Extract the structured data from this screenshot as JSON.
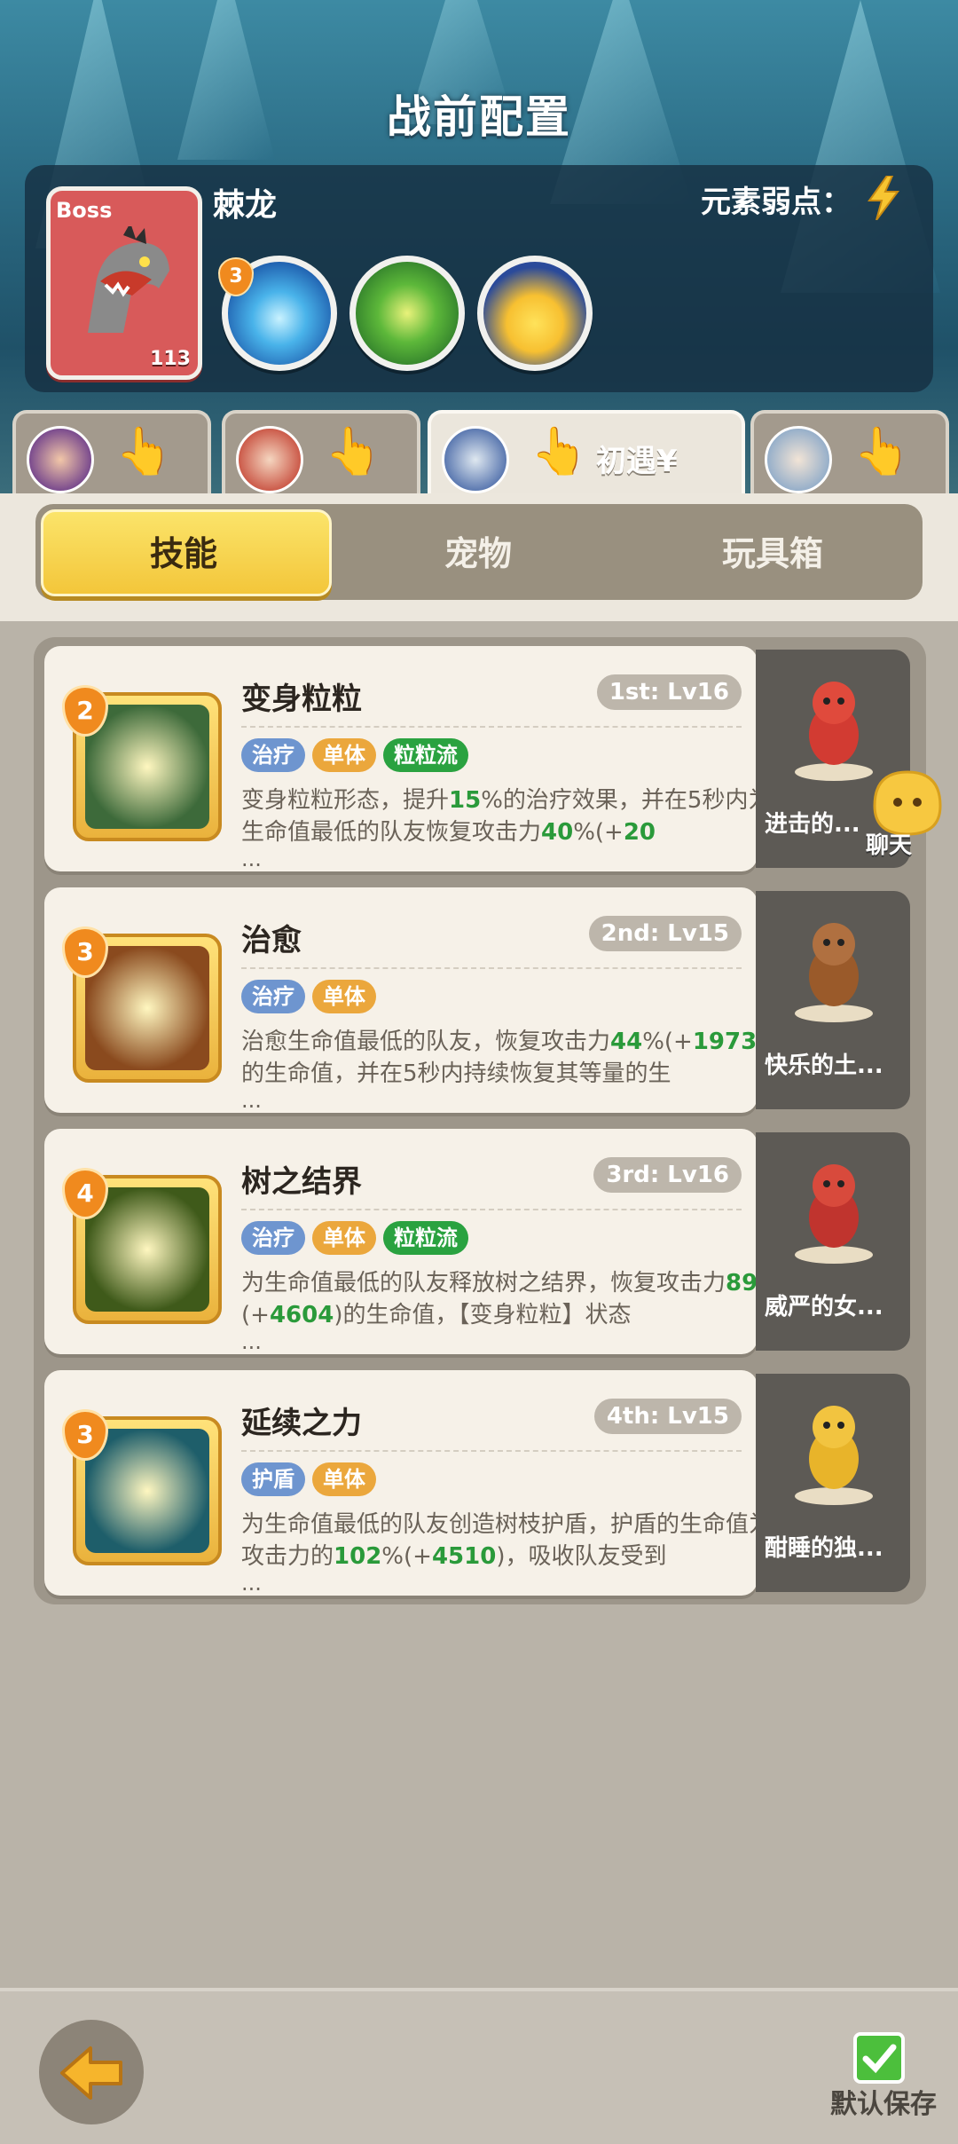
{
  "header": {
    "title": "战前配置"
  },
  "boss": {
    "tag": "Boss",
    "level": "113",
    "name": "棘龙",
    "weakness_label": "元素弱点：",
    "weakness_icon": "lightning-icon",
    "skills": [
      {
        "icon": "water-burst-icon",
        "badge": "3"
      },
      {
        "icon": "green-scroll-icon"
      },
      {
        "icon": "yellow-creature-icon"
      }
    ]
  },
  "team_tabs": [
    {
      "avatar": "hero-avatar-1"
    },
    {
      "avatar": "hero-avatar-2"
    },
    {
      "avatar": "hero-avatar-3",
      "label": "初遇¥",
      "active": true
    },
    {
      "avatar": "hero-avatar-4"
    }
  ],
  "segment": {
    "tabs": [
      "技能",
      "宠物",
      "玩具箱"
    ],
    "active": "技能"
  },
  "skills": [
    {
      "badge": "2",
      "name": "变身粒粒",
      "rank": "1st: Lv16",
      "tags": [
        {
          "label": "治疗",
          "color": "#6e95cf"
        },
        {
          "label": "单体",
          "color": "#eba73c"
        },
        {
          "label": "粒粒流",
          "color": "#2aa240"
        }
      ],
      "desc": [
        {
          "t": "变身粒粒形态，提升"
        },
        {
          "t": "15",
          "g": true
        },
        {
          "t": "%的治疗效果，并在5秒内为生命值最低的队友恢复攻击力"
        },
        {
          "t": "40",
          "g": true
        },
        {
          "t": "%(+"
        },
        {
          "t": "20",
          "g": true
        }
      ],
      "pet": "进击的...",
      "icon_color": "#3d6a3a"
    },
    {
      "badge": "3",
      "name": "治愈",
      "rank": "2nd: Lv15",
      "tags": [
        {
          "label": "治疗",
          "color": "#6e95cf"
        },
        {
          "label": "单体",
          "color": "#eba73c"
        }
      ],
      "desc": [
        {
          "t": "治愈生命值最低的队友，恢复攻击力"
        },
        {
          "t": "44",
          "g": true
        },
        {
          "t": "%(+"
        },
        {
          "t": "1973",
          "g": true
        },
        {
          "t": ")的生命值，并在5秒内持续恢复其等量的生"
        }
      ],
      "pet": "快乐的土...",
      "icon_color": "#8a4a1e"
    },
    {
      "badge": "4",
      "name": "树之结界",
      "rank": "3rd: Lv16",
      "tags": [
        {
          "label": "治疗",
          "color": "#6e95cf"
        },
        {
          "label": "单体",
          "color": "#eba73c"
        },
        {
          "label": "粒粒流",
          "color": "#2aa240"
        }
      ],
      "desc": [
        {
          "t": "为生命值最低的队友释放树之结界，恢复攻击力"
        },
        {
          "t": "89",
          "g": true
        },
        {
          "t": "%(+"
        },
        {
          "t": "4604",
          "g": true
        },
        {
          "t": ")的生命值，【变身粒粒】状态"
        }
      ],
      "pet": "威严的女...",
      "icon_color": "#3f5a1a"
    },
    {
      "badge": "3",
      "name": "延续之力",
      "rank": "4th: Lv15",
      "tags": [
        {
          "label": "护盾",
          "color": "#6e95cf"
        },
        {
          "label": "单体",
          "color": "#eba73c"
        }
      ],
      "desc": [
        {
          "t": "为生命值最低的队友创造树枝护盾，护盾的生命值为攻击力的"
        },
        {
          "t": "102",
          "g": true
        },
        {
          "t": "%(+"
        },
        {
          "t": "4510",
          "g": true
        },
        {
          "t": ")，吸收队友受到"
        }
      ],
      "pet": "酣睡的独...",
      "icon_color": "#1e5e6a"
    }
  ],
  "ellipsis": "...",
  "chat": {
    "label": "聊天"
  },
  "footer": {
    "save_label": "默认保存"
  }
}
